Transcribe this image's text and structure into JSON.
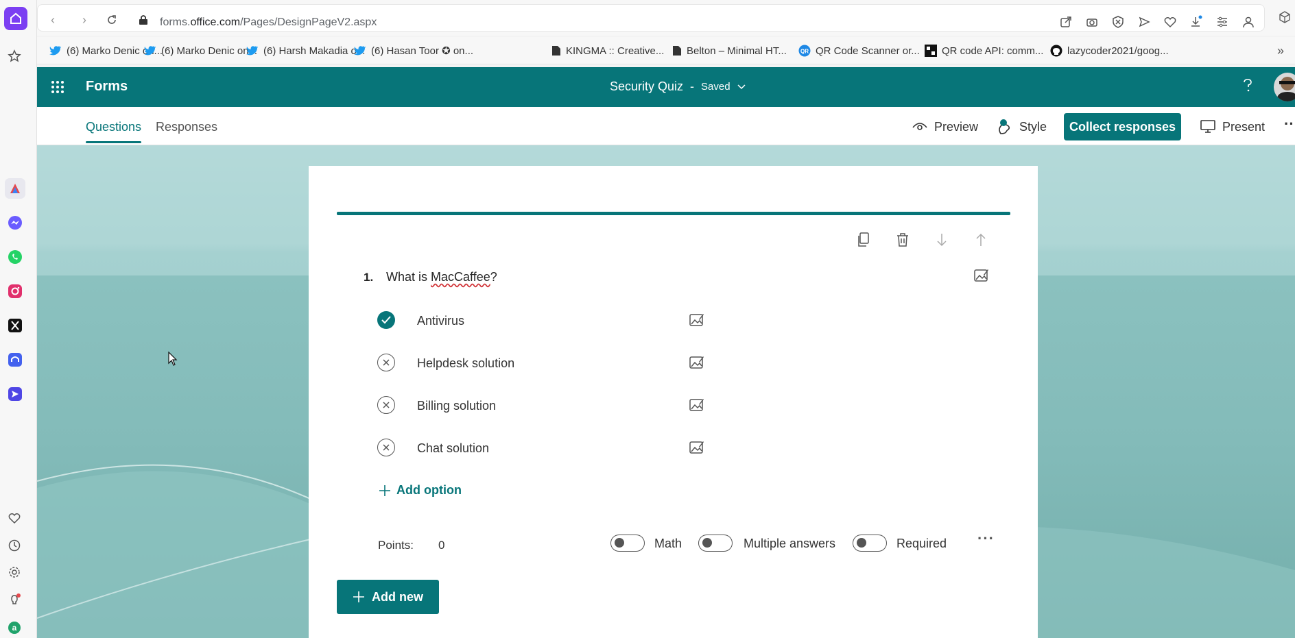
{
  "browser": {
    "url_prefix": "forms.",
    "url_domain": "office.com",
    "url_path": "/Pages/DesignPageV2.aspx",
    "bookmarks": [
      {
        "icon": "twitter-icon",
        "label": "(6) Marko Denic on..."
      },
      {
        "icon": "twitter-icon",
        "label": "(6) Marko Denic on..."
      },
      {
        "icon": "twitter-icon",
        "label": "(6) Harsh Makadia o..."
      },
      {
        "icon": "twitter-icon",
        "label": "(6) Hasan Toor ✪ on..."
      },
      {
        "icon": "file-icon",
        "label": "KINGMA :: Creative..."
      },
      {
        "icon": "file-icon",
        "label": "Belton – Minimal HT..."
      },
      {
        "icon": "qr-icon",
        "label": "QR Code Scanner or..."
      },
      {
        "icon": "qr-code-icon",
        "label": "QR code API: comm..."
      },
      {
        "icon": "github-icon",
        "label": "lazycoder2021/goog..."
      }
    ]
  },
  "header": {
    "app_name": "Forms",
    "doc_title": "Security Quiz",
    "separator": "-",
    "status": "Saved"
  },
  "tabs": [
    {
      "label": "Questions",
      "active": true
    },
    {
      "label": "Responses",
      "active": false
    }
  ],
  "toolbar": {
    "preview": "Preview",
    "style": "Style",
    "collect": "Collect responses",
    "present": "Present"
  },
  "question": {
    "number": "1.",
    "text_before": "What is ",
    "text_misspelled": "MacCaffee",
    "text_after": "?",
    "options": [
      {
        "label": "Antivirus",
        "correct": true
      },
      {
        "label": "Helpdesk solution",
        "correct": false
      },
      {
        "label": "Billing solution",
        "correct": false
      },
      {
        "label": "Chat solution",
        "correct": false
      }
    ],
    "add_option": "Add option",
    "points_label": "Points:",
    "points_value": "0",
    "toggles": {
      "math": {
        "label": "Math",
        "on": false
      },
      "multiple": {
        "label": "Multiple answers",
        "on": false
      },
      "required": {
        "label": "Required",
        "on": false
      }
    }
  },
  "add_new": "Add new",
  "colors": {
    "accent": "#077579",
    "background": "#a2cfcd"
  }
}
